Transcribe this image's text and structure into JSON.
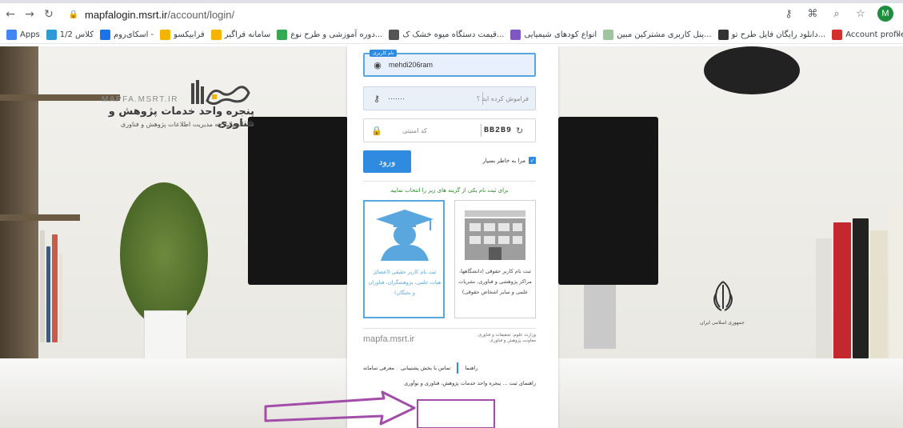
{
  "browser": {
    "url_host": "mapfalogin.msrt.ir",
    "url_path": "/account/login/",
    "avatar_letter": "M",
    "bookmarks": [
      {
        "label": "Apps",
        "color": "#4285f4"
      },
      {
        "label": "کلاس 1/2",
        "color": "#2e9bd6"
      },
      {
        "label": "اسکای‌روم -",
        "color": "#1a73e8"
      },
      {
        "label": "فرابیکسو",
        "color": "#f4b400"
      },
      {
        "label": "سامانه فراگیر",
        "color": "#f4b400"
      },
      {
        "label": "دوره آموزشی و طرح نوع...",
        "color": "#34a853"
      },
      {
        "label": "قیمت دستگاه میوه خشک ک...",
        "color": "#555555"
      },
      {
        "label": "انواع کودهای شیمیایی",
        "color": "#7e57c2"
      },
      {
        "label": "پنل کاربری مشترکین مبین...",
        "color": "#a0c4a0"
      },
      {
        "label": "دانلود رایگان فایل طرح تو...",
        "color": "#333333"
      },
      {
        "label": "Account profile - I...",
        "color": "#d32f2f"
      }
    ]
  },
  "brand": {
    "site": "MAPFA.MSRT.IR",
    "title": "پنجره واحد خدمات پژوهش و فناوری",
    "subtitle": "سامانه یکپارچه مدیریت اطلاعات پژوهش و فناوری"
  },
  "emblem_caption": "جمهوری اسلامی ایران",
  "login": {
    "username_badge": "نام کاربری",
    "username_value": "mehdi206ram",
    "password_value": "·······",
    "password_hint": "فراموش کرده اید ؟",
    "captcha_placeholder": "کد امنیتی",
    "captcha_code": "BB2B9",
    "login_button": "ورود",
    "remember_label": "مرا به خاطر بسپار"
  },
  "registration": {
    "hint": "برای ثبت نام یکی از گزینه های زیر را انتخاب نمایید",
    "legal": "ثبت نام کاربر حقوقی (دانشگاهها، مراکز پژوهشی و فناوری، نشریات علمی و سایر اشخاص حقوقی)",
    "natural": "ثبت نام کاربر حقیقی (اعضای هیات علمی، پژوهشگران، فناوران و نخبگان)"
  },
  "footer": {
    "site": "mapfa.msrt.ir",
    "ministry": "وزارت علوم، تحقیقات و فناوری معاونت پژوهش و فناوری",
    "nav": [
      "معرفی سامانه",
      "تماس با بخش پشتیبانی",
      "راهنما"
    ],
    "more": "راهنمای ثبت ... پنجره واحد خدمات پژوهش، فناوری و نوآوری"
  },
  "colors": {
    "accent": "#2f8be0",
    "highlight": "#a24ea8"
  }
}
